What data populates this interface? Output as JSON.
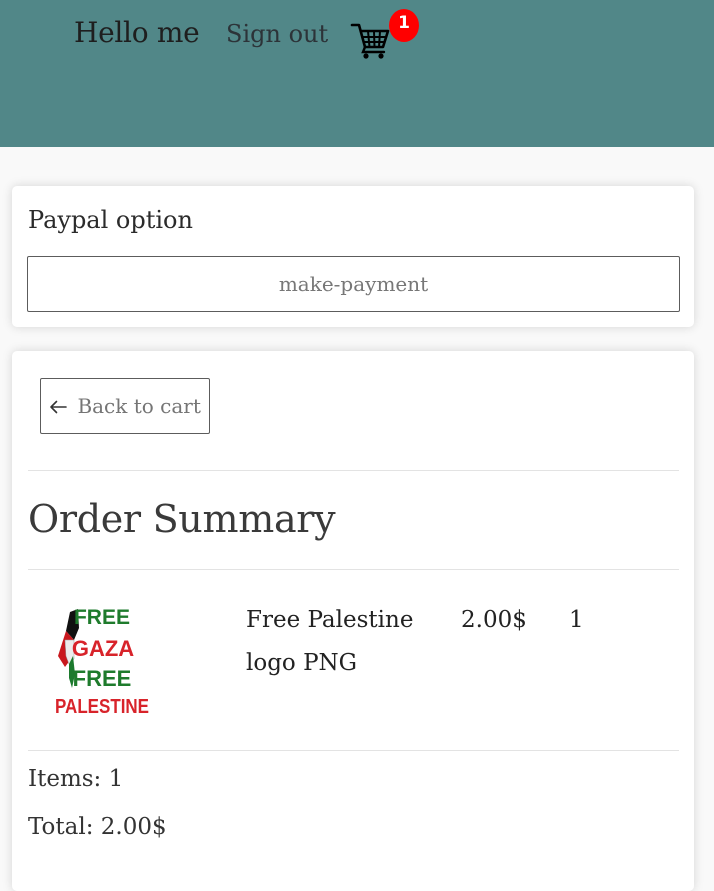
{
  "header": {
    "greeting": "Hello me",
    "signout_label": "Sign out",
    "cart_icon": "shopping-cart-icon",
    "cart_count": "1",
    "background_color": "#518788",
    "badge_color": "#ff0000"
  },
  "payment": {
    "title": "Paypal option",
    "button_label": "make-payment"
  },
  "summary": {
    "back_label": "Back to cart",
    "back_icon": "arrow-left-icon",
    "title": "Order Summary",
    "items": [
      {
        "name": "Free Palestine logo PNG",
        "price": "2.00$",
        "quantity": "1",
        "image_text": [
          "FREE",
          "GAZA",
          "FREE",
          "PALESTINE"
        ]
      }
    ],
    "items_text": "Items: 1",
    "total_text": "Total: 2.00$"
  }
}
